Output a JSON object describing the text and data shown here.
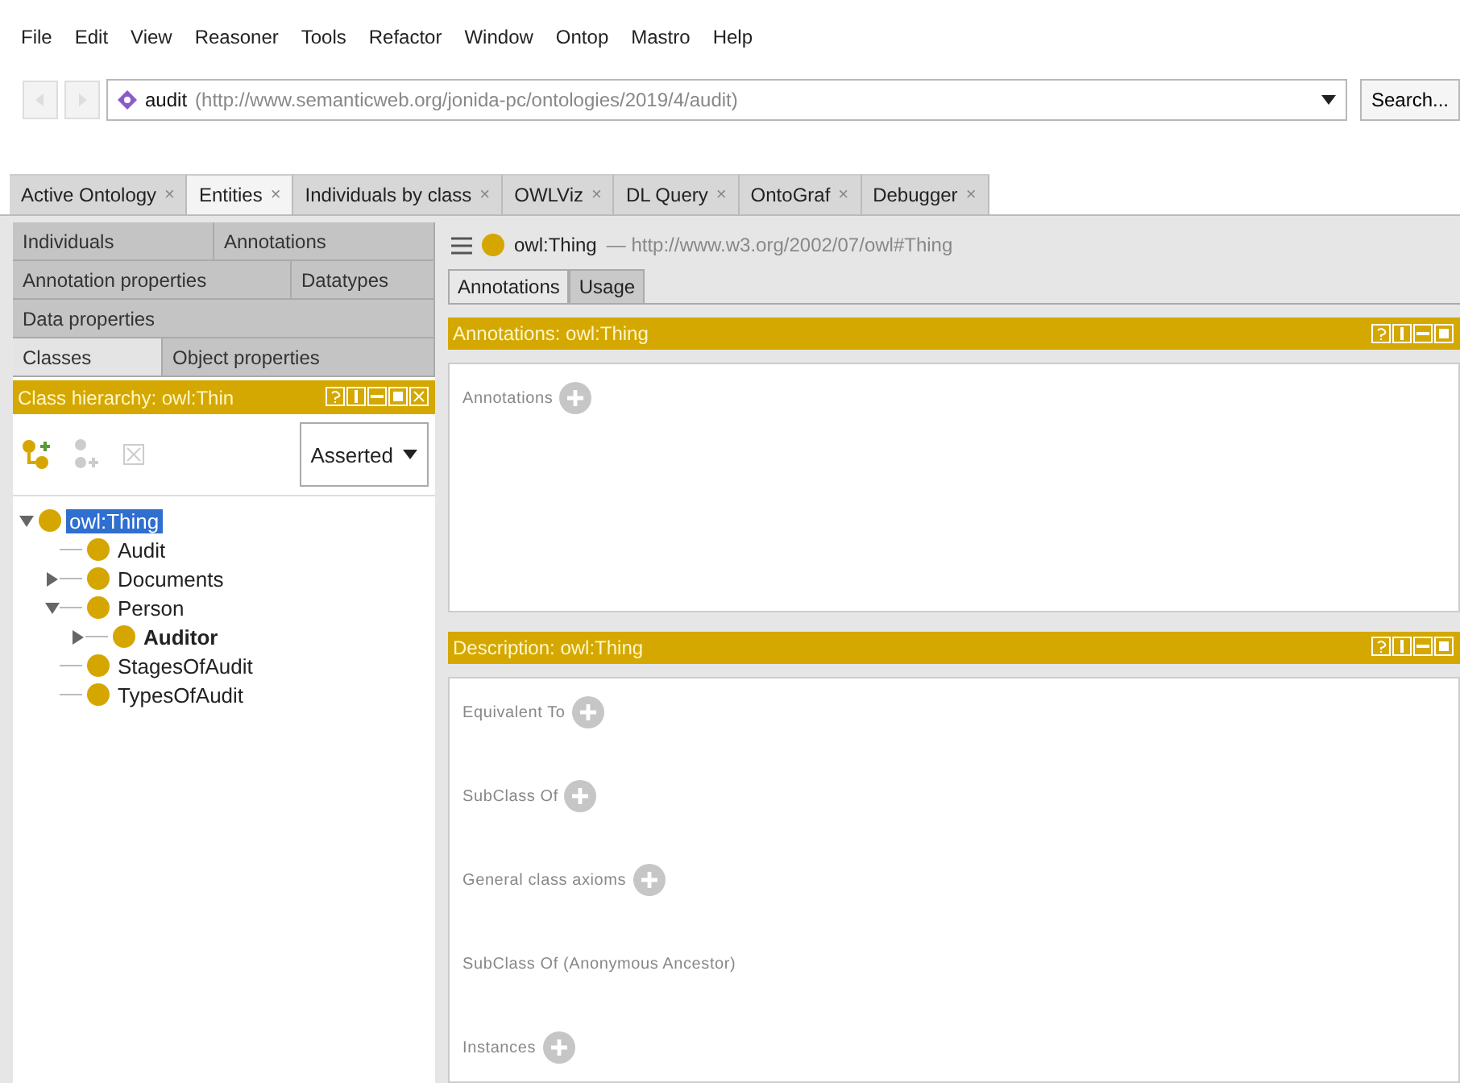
{
  "menu": [
    "File",
    "Edit",
    "View",
    "Reasoner",
    "Tools",
    "Refactor",
    "Window",
    "Ontop",
    "Mastro",
    "Help"
  ],
  "address": {
    "name": "audit",
    "iri": "(http://www.semanticweb.org/jonida-pc/ontologies/2019/4/audit)",
    "search": "Search..."
  },
  "tabs": [
    {
      "label": "Active Ontology",
      "selected": false,
      "close": "×"
    },
    {
      "label": "Entities",
      "selected": true,
      "close": "×"
    },
    {
      "label": "Individuals by class",
      "selected": false,
      "close": "×"
    },
    {
      "label": "OWLViz",
      "selected": false,
      "close": "×"
    },
    {
      "label": "DL Query",
      "selected": false,
      "close": "×"
    },
    {
      "label": "OntoGraf",
      "selected": false,
      "close": "×"
    },
    {
      "label": "Debugger",
      "selected": false,
      "close": "×"
    }
  ],
  "entity_tabs": [
    [
      {
        "label": "Individuals",
        "selected": false
      },
      {
        "label": "Annotations",
        "selected": false
      }
    ],
    [
      {
        "label": "Annotation properties",
        "selected": false
      },
      {
        "label": "Datatypes",
        "selected": false
      }
    ],
    [
      {
        "label": "Data properties",
        "selected": false
      }
    ],
    [
      {
        "label": "Classes",
        "selected": true
      },
      {
        "label": "Object properties",
        "selected": false
      }
    ]
  ],
  "hierarchy": {
    "title": "Class hierarchy: owl:Thin",
    "mode": "Asserted",
    "tree": [
      {
        "label": "owl:Thing",
        "selected": true,
        "bold": false,
        "expandable": true,
        "expanded": true,
        "children": [
          {
            "label": "Audit",
            "selected": false,
            "bold": false,
            "expandable": false,
            "expanded": false
          },
          {
            "label": "Documents",
            "selected": false,
            "bold": false,
            "expandable": true,
            "expanded": false
          },
          {
            "label": "Person",
            "selected": false,
            "bold": false,
            "expandable": true,
            "expanded": true,
            "children": [
              {
                "label": "Auditor",
                "selected": false,
                "bold": true,
                "expandable": true,
                "expanded": false
              }
            ]
          },
          {
            "label": "StagesOfAudit",
            "selected": false,
            "bold": false,
            "expandable": false,
            "expanded": false
          },
          {
            "label": "TypesOfAudit",
            "selected": false,
            "bold": false,
            "expandable": false,
            "expanded": false
          }
        ]
      }
    ]
  },
  "entity": {
    "name": "owl:Thing",
    "iri": "— http://www.w3.org/2002/07/owl#Thing"
  },
  "view_tabs": [
    {
      "label": "Annotations",
      "selected": true
    },
    {
      "label": "Usage",
      "selected": false
    }
  ],
  "annotations": {
    "title": "Annotations: owl:Thing",
    "sections": [
      {
        "label": "Annotations",
        "addable": true
      }
    ]
  },
  "description": {
    "title": "Description: owl:Thing",
    "sections": [
      {
        "label": "Equivalent To",
        "addable": true
      },
      {
        "label": "SubClass Of",
        "addable": true
      },
      {
        "label": "General class axioms",
        "addable": true
      },
      {
        "label": "SubClass Of (Anonymous Ancestor)",
        "addable": false
      },
      {
        "label": "Instances",
        "addable": true
      }
    ]
  }
}
